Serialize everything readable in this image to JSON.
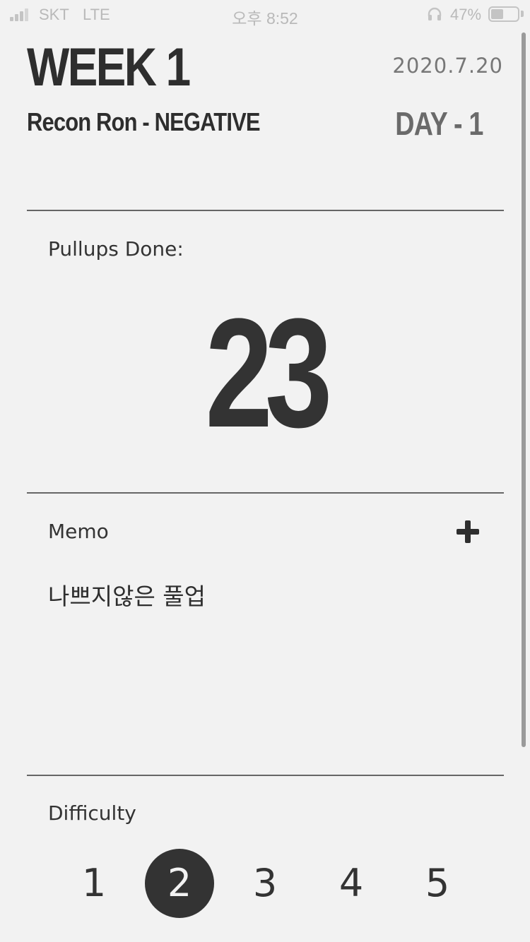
{
  "status_bar": {
    "carrier": "SKT",
    "network": "LTE",
    "time": "오후 8:52",
    "battery_percent": "47%",
    "battery_level": 0.47,
    "icons": [
      "signal-icon",
      "headphones-icon",
      "battery-icon"
    ]
  },
  "header": {
    "week_title": "WEEK 1",
    "date": "2020.7.20",
    "program_name": "Recon Ron - NEGATIVE",
    "day_label": "DAY - 1"
  },
  "pullups": {
    "label": "Pullups Done:",
    "count": "23"
  },
  "memo": {
    "label": "Memo",
    "add_icon": "plus-icon",
    "text": "나쁘지않은 풀업"
  },
  "difficulty": {
    "label": "Difficulty",
    "options": [
      "1",
      "2",
      "3",
      "4",
      "5"
    ],
    "selected": "2"
  },
  "colors": {
    "background": "#f2f2f2",
    "text_dark": "#2e2e2e",
    "text_muted": "#777777",
    "selected_fill": "#333333"
  }
}
